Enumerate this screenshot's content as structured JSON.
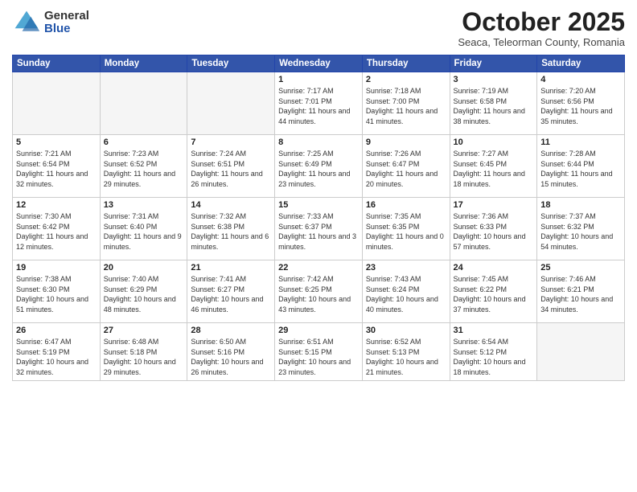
{
  "logo": {
    "general": "General",
    "blue": "Blue"
  },
  "header": {
    "month": "October 2025",
    "location": "Seaca, Teleorman County, Romania"
  },
  "weekdays": [
    "Sunday",
    "Monday",
    "Tuesday",
    "Wednesday",
    "Thursday",
    "Friday",
    "Saturday"
  ],
  "weeks": [
    [
      {
        "day": "",
        "info": ""
      },
      {
        "day": "",
        "info": ""
      },
      {
        "day": "",
        "info": ""
      },
      {
        "day": "1",
        "info": "Sunrise: 7:17 AM\nSunset: 7:01 PM\nDaylight: 11 hours and 44 minutes."
      },
      {
        "day": "2",
        "info": "Sunrise: 7:18 AM\nSunset: 7:00 PM\nDaylight: 11 hours and 41 minutes."
      },
      {
        "day": "3",
        "info": "Sunrise: 7:19 AM\nSunset: 6:58 PM\nDaylight: 11 hours and 38 minutes."
      },
      {
        "day": "4",
        "info": "Sunrise: 7:20 AM\nSunset: 6:56 PM\nDaylight: 11 hours and 35 minutes."
      }
    ],
    [
      {
        "day": "5",
        "info": "Sunrise: 7:21 AM\nSunset: 6:54 PM\nDaylight: 11 hours and 32 minutes."
      },
      {
        "day": "6",
        "info": "Sunrise: 7:23 AM\nSunset: 6:52 PM\nDaylight: 11 hours and 29 minutes."
      },
      {
        "day": "7",
        "info": "Sunrise: 7:24 AM\nSunset: 6:51 PM\nDaylight: 11 hours and 26 minutes."
      },
      {
        "day": "8",
        "info": "Sunrise: 7:25 AM\nSunset: 6:49 PM\nDaylight: 11 hours and 23 minutes."
      },
      {
        "day": "9",
        "info": "Sunrise: 7:26 AM\nSunset: 6:47 PM\nDaylight: 11 hours and 20 minutes."
      },
      {
        "day": "10",
        "info": "Sunrise: 7:27 AM\nSunset: 6:45 PM\nDaylight: 11 hours and 18 minutes."
      },
      {
        "day": "11",
        "info": "Sunrise: 7:28 AM\nSunset: 6:44 PM\nDaylight: 11 hours and 15 minutes."
      }
    ],
    [
      {
        "day": "12",
        "info": "Sunrise: 7:30 AM\nSunset: 6:42 PM\nDaylight: 11 hours and 12 minutes."
      },
      {
        "day": "13",
        "info": "Sunrise: 7:31 AM\nSunset: 6:40 PM\nDaylight: 11 hours and 9 minutes."
      },
      {
        "day": "14",
        "info": "Sunrise: 7:32 AM\nSunset: 6:38 PM\nDaylight: 11 hours and 6 minutes."
      },
      {
        "day": "15",
        "info": "Sunrise: 7:33 AM\nSunset: 6:37 PM\nDaylight: 11 hours and 3 minutes."
      },
      {
        "day": "16",
        "info": "Sunrise: 7:35 AM\nSunset: 6:35 PM\nDaylight: 11 hours and 0 minutes."
      },
      {
        "day": "17",
        "info": "Sunrise: 7:36 AM\nSunset: 6:33 PM\nDaylight: 10 hours and 57 minutes."
      },
      {
        "day": "18",
        "info": "Sunrise: 7:37 AM\nSunset: 6:32 PM\nDaylight: 10 hours and 54 minutes."
      }
    ],
    [
      {
        "day": "19",
        "info": "Sunrise: 7:38 AM\nSunset: 6:30 PM\nDaylight: 10 hours and 51 minutes."
      },
      {
        "day": "20",
        "info": "Sunrise: 7:40 AM\nSunset: 6:29 PM\nDaylight: 10 hours and 48 minutes."
      },
      {
        "day": "21",
        "info": "Sunrise: 7:41 AM\nSunset: 6:27 PM\nDaylight: 10 hours and 46 minutes."
      },
      {
        "day": "22",
        "info": "Sunrise: 7:42 AM\nSunset: 6:25 PM\nDaylight: 10 hours and 43 minutes."
      },
      {
        "day": "23",
        "info": "Sunrise: 7:43 AM\nSunset: 6:24 PM\nDaylight: 10 hours and 40 minutes."
      },
      {
        "day": "24",
        "info": "Sunrise: 7:45 AM\nSunset: 6:22 PM\nDaylight: 10 hours and 37 minutes."
      },
      {
        "day": "25",
        "info": "Sunrise: 7:46 AM\nSunset: 6:21 PM\nDaylight: 10 hours and 34 minutes."
      }
    ],
    [
      {
        "day": "26",
        "info": "Sunrise: 6:47 AM\nSunset: 5:19 PM\nDaylight: 10 hours and 32 minutes."
      },
      {
        "day": "27",
        "info": "Sunrise: 6:48 AM\nSunset: 5:18 PM\nDaylight: 10 hours and 29 minutes."
      },
      {
        "day": "28",
        "info": "Sunrise: 6:50 AM\nSunset: 5:16 PM\nDaylight: 10 hours and 26 minutes."
      },
      {
        "day": "29",
        "info": "Sunrise: 6:51 AM\nSunset: 5:15 PM\nDaylight: 10 hours and 23 minutes."
      },
      {
        "day": "30",
        "info": "Sunrise: 6:52 AM\nSunset: 5:13 PM\nDaylight: 10 hours and 21 minutes."
      },
      {
        "day": "31",
        "info": "Sunrise: 6:54 AM\nSunset: 5:12 PM\nDaylight: 10 hours and 18 minutes."
      },
      {
        "day": "",
        "info": ""
      }
    ]
  ]
}
